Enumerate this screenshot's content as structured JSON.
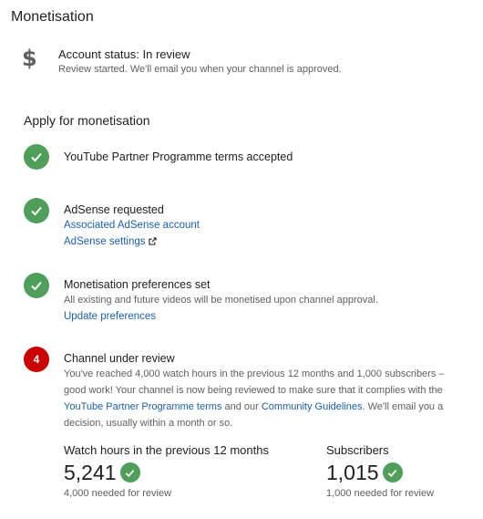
{
  "page": {
    "title": "Monetisation"
  },
  "account_status": {
    "icon": "dollar-icon",
    "title": "Account status: In review",
    "description": "Review started. We'll email you when your channel is approved."
  },
  "apply": {
    "heading": "Apply for monetisation",
    "steps": [
      {
        "status": "done",
        "title": "YouTube Partner Programme terms accepted"
      },
      {
        "status": "done",
        "title": "AdSense requested",
        "links": [
          "Associated AdSense account",
          "AdSense settings"
        ]
      },
      {
        "status": "done",
        "title": "Monetisation preferences set",
        "description": "All existing and future videos will be monetised upon channel approval.",
        "links": [
          "Update preferences"
        ]
      },
      {
        "status": "current",
        "number": "4",
        "title": "Channel under review",
        "desc_part1": "You've reached 4,000 watch hours in the previous 12 months and 1,000 subscribers – good work! Your channel is now being reviewed to make sure that it complies with the ",
        "link1": "YouTube Partner Programme terms",
        "desc_part2": " and our ",
        "link2": "Community Guidelines",
        "desc_part3": ". We'll email you a decision, usually within a month or so."
      }
    ]
  },
  "metrics": {
    "watch_hours": {
      "label": "Watch hours in the previous 12 months",
      "value": "5,241",
      "note": "4,000 needed for review"
    },
    "subscribers": {
      "label": "Subscribers",
      "value": "1,015",
      "note": "1,000 needed for review"
    }
  },
  "colors": {
    "success": "#4f9e5a",
    "alert": "#cc0000",
    "link": "#1a5fb4",
    "secondary_text": "#606060"
  }
}
